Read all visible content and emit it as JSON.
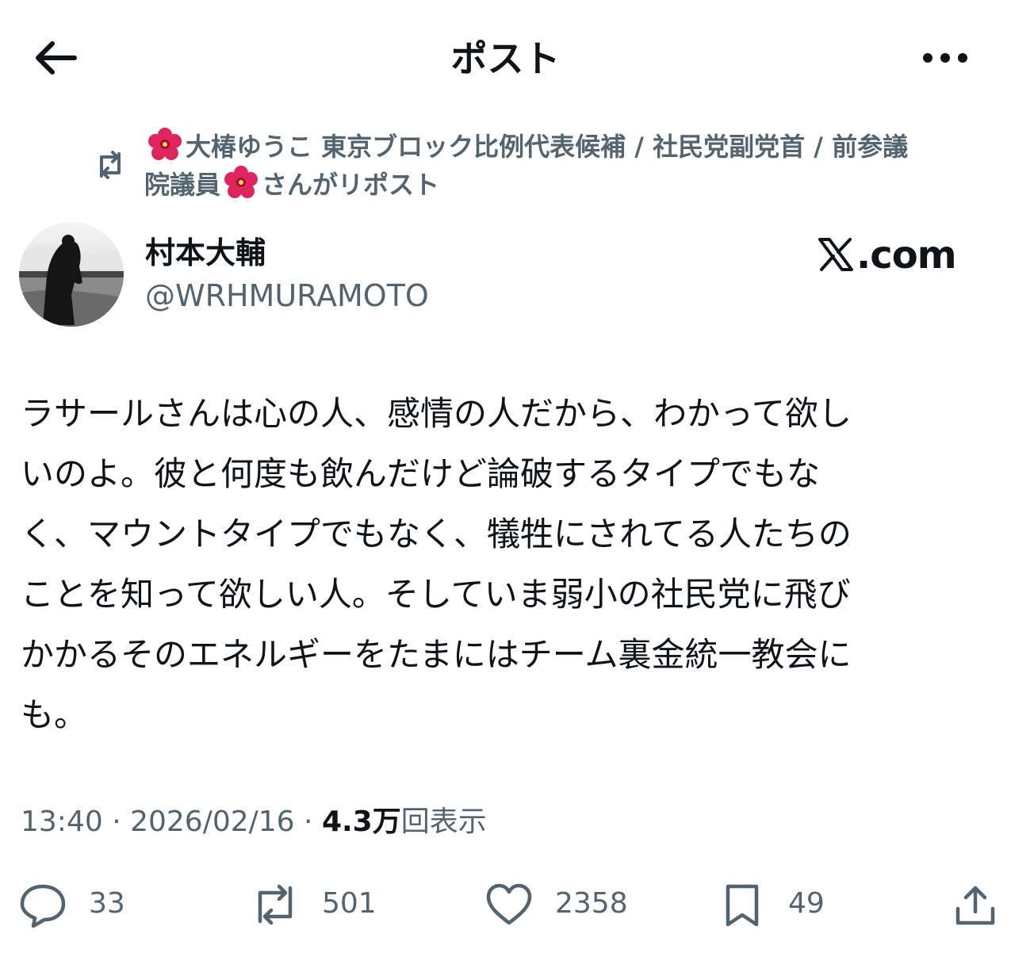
{
  "header": {
    "title": "ポスト",
    "back_icon": "arrow-left-icon",
    "more_icon": "more-horizontal-icon"
  },
  "repost": {
    "icon": "repost-icon",
    "name_part1": "大椿ゆうこ 東京ブロック比例代表候補 / 社民党副党首 / 前参議",
    "name_part2": "院議員",
    "suffix": "さんがリポスト",
    "emoji": "hibiscus-emoji"
  },
  "author": {
    "name": "村本大輔",
    "handle": "@WRHMURAMOTO",
    "brand": ".com"
  },
  "post": {
    "lines": [
      "ラサールさんは心の人、感情の人だから、わかって欲し",
      "いのよ。彼と何度も飲んだけど論破するタイプでもな",
      "く、マウントタイプでもなく、犠牲にされてる人たちの",
      "ことを知って欲しい人。そしていま弱小の社民党に飛び",
      "かかるそのエネルギーをたまにはチーム裏金統一教会に",
      "も。"
    ]
  },
  "meta": {
    "time": "13:40",
    "separator": " · ",
    "date": "2026/02/16",
    "views_count": "4.3万",
    "views_label": "回表示"
  },
  "actions": {
    "reply_count": "33",
    "repost_count": "501",
    "like_count": "2358",
    "bookmark_count": "49"
  },
  "colors": {
    "text": "#0f1419",
    "secondary": "#536471",
    "hibiscus": "#e0245e"
  }
}
